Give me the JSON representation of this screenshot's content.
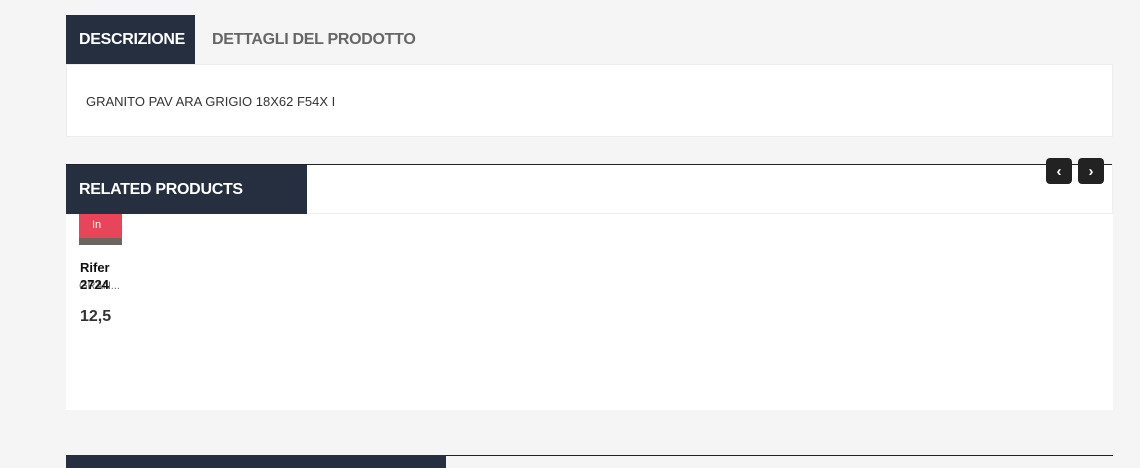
{
  "tabs": [
    {
      "label": "DESCRIZIONE",
      "active": true
    },
    {
      "label": "DETTAGLI DEL PRODOTTO",
      "active": false
    }
  ],
  "description": {
    "text": "GRANITO PAV ARA GRIGIO 18X62 F54X I"
  },
  "related": {
    "title": "RELATED PRODUCTS",
    "prev_icon": "chevron-left-icon",
    "next_icon": "chevron-right-icon",
    "prev_glyph": "‹",
    "next_glyph": "›",
    "card": {
      "badge": "In",
      "name": "GRAN...",
      "ref_line1": "Rifer",
      "ref_line2": "2724",
      "price": "12,5"
    }
  },
  "colors": {
    "header_bg": "#252f3f",
    "badge_bg": "#e8455a",
    "page_bg": "#f5f5f5"
  }
}
